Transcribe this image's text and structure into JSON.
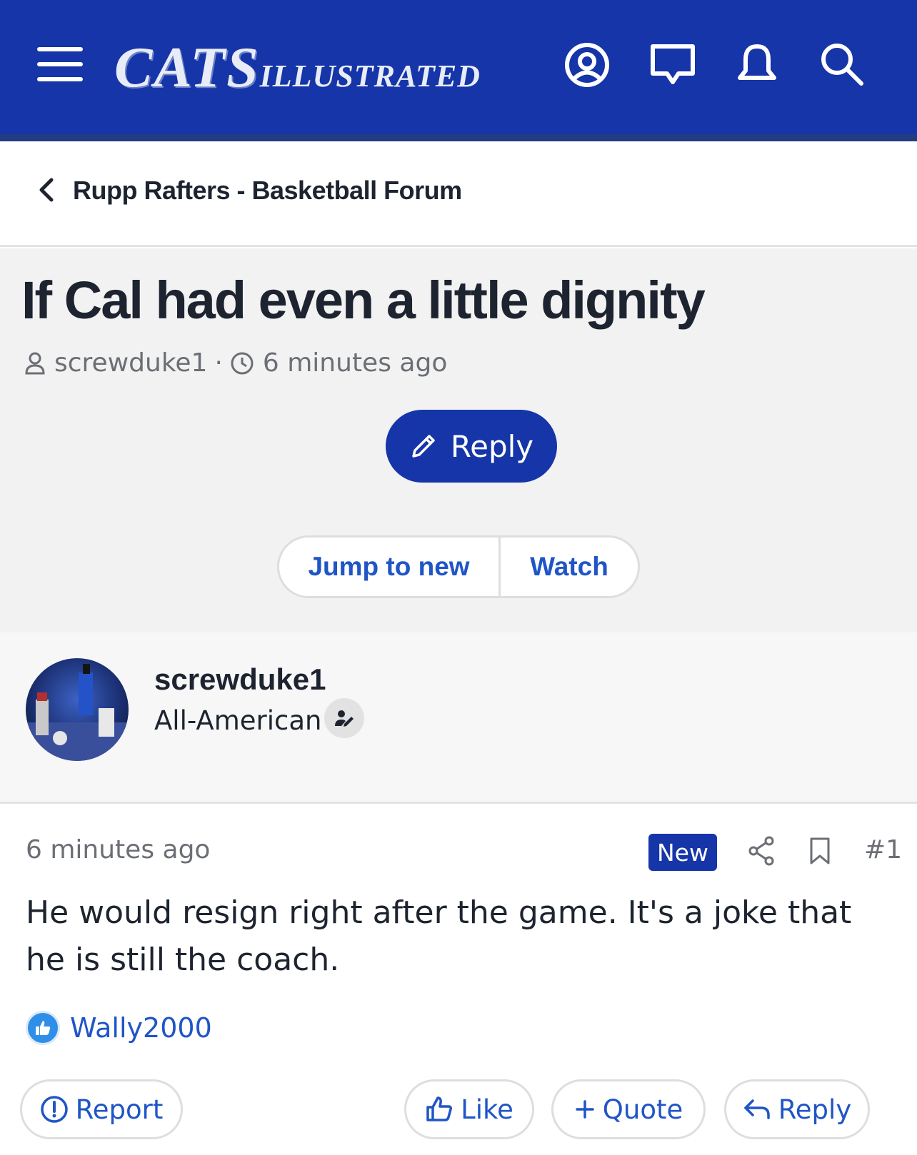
{
  "header": {
    "brand_main": "CATS",
    "brand_sub": "ILLUSTRATED",
    "icons": [
      "menu-icon",
      "account-icon",
      "messages-icon",
      "alerts-icon",
      "search-icon"
    ],
    "background": "#1535a8"
  },
  "breadcrumb": {
    "label": "Rupp Rafters - Basketball Forum"
  },
  "thread": {
    "title": "If Cal had even a little dignity",
    "author": "screwduke1",
    "separator": "·",
    "time": "6 minutes ago",
    "reply_label": "Reply",
    "jump_label": "Jump to new",
    "watch_label": "Watch"
  },
  "post": {
    "author": "screwduke1",
    "rank": "All-American",
    "time": "6 minutes ago",
    "badge": "New",
    "number": "#1",
    "body": "He would resign right after the game. It's a joke that he is still the coach.",
    "liked_by": "Wally2000",
    "actions": {
      "report": "Report",
      "like": "Like",
      "quote": "Quote",
      "reply": "Reply"
    }
  },
  "colors": {
    "accent": "#1535a8",
    "link": "#1f55c6"
  }
}
